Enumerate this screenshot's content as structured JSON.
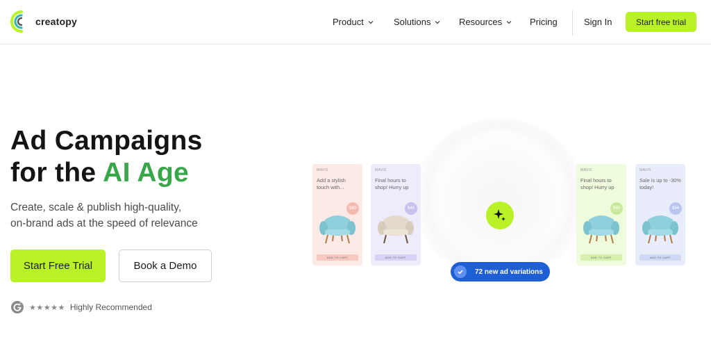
{
  "nav": {
    "logo_text": "creatopy",
    "menu": [
      {
        "label": "Product",
        "has_dropdown": true
      },
      {
        "label": "Solutions",
        "has_dropdown": true
      },
      {
        "label": "Resources",
        "has_dropdown": true
      },
      {
        "label": "Pricing",
        "has_dropdown": false
      }
    ],
    "sign_in": "Sign In",
    "cta": "Start free trial"
  },
  "hero": {
    "headline_line1": "Ad Campaigns",
    "headline_line2_prefix": "for the ",
    "headline_line2_accent": "AI Age",
    "subtext_line1": "Create, scale & publish high-quality,",
    "subtext_line2": "on-brand ads at the speed of relevance",
    "primary_cta": "Start Free Trial",
    "secondary_cta": "Book a Demo",
    "rating_text": "Highly Recommended",
    "stars": "★★★★★",
    "rating_icon": "g2-icon"
  },
  "visual": {
    "cards": [
      {
        "brand": "MAVIS",
        "text": "Add a stylish touch with...",
        "price": "$80",
        "button": "ADD TO CART",
        "bg": "#fde9e6",
        "price_bg": "#f4b9b0",
        "btn_bg": "#f7c9c1",
        "chair": "blue"
      },
      {
        "brand": "MAVIS",
        "text": "Final hours to shop! Hurry up",
        "price": "$40",
        "button": "ADD TO CART",
        "bg": "#eeebfb",
        "price_bg": "#c8c0ef",
        "btn_bg": "#d8d2f5",
        "chair": "beige"
      },
      {
        "brand": "MAVIS",
        "text": "Final hours to shop! Hurry up",
        "price": "$40",
        "button": "ADD TO CART",
        "bg": "#eefbdc",
        "price_bg": "#cbe99c",
        "btn_bg": "#d7f0ae",
        "chair": "blue"
      },
      {
        "brand": "MAVIS",
        "text": "Sale is up to -30% today!",
        "price": "$94",
        "button": "ADD TO CART",
        "bg": "#e9edfb",
        "price_bg": "#b9c5ee",
        "btn_bg": "#cfd8f5",
        "chair": "blue"
      }
    ],
    "badge_text": "72 new ad variations",
    "spark_icon": "sparkle-icon"
  },
  "colors": {
    "accent_lime": "#b8f227",
    "accent_green_text": "#3aa64a",
    "badge_blue": "#1f5fd6"
  }
}
